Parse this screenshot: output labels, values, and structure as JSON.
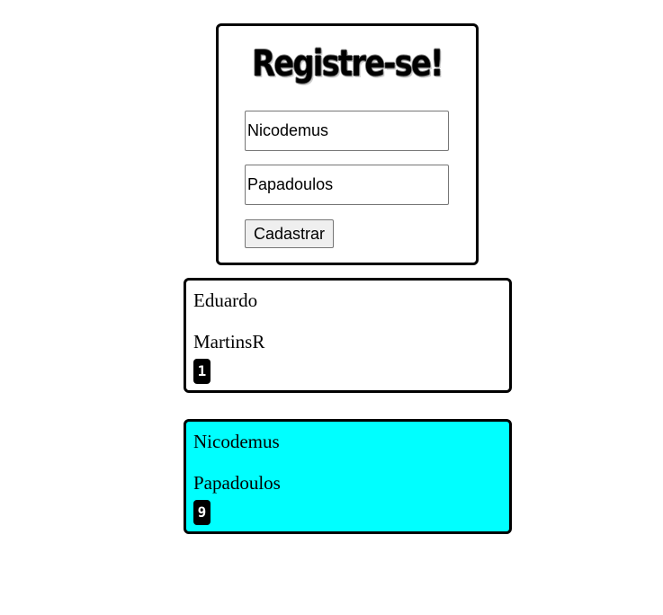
{
  "form": {
    "title": "Registre-se!",
    "first_name_value": "Nicodemus",
    "last_name_value": "Papadoulos",
    "submit_label": "Cadastrar"
  },
  "users": [
    {
      "first_name": "Eduardo",
      "last_name": "MartinsR",
      "badge": "1",
      "background": "#ffffff"
    },
    {
      "first_name": "Nicodemus",
      "last_name": "Papadoulos",
      "badge": "9",
      "background": "#00ffff"
    }
  ]
}
